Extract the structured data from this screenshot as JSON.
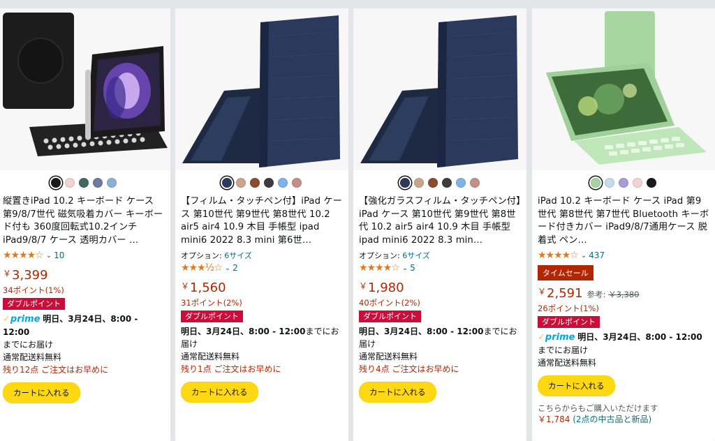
{
  "products": [
    {
      "image_icon": "ipad-keyboard-case-black-icon",
      "swatches": [
        "#1a1a1a",
        "#f2d3d3",
        "#3d6b64",
        "#6f7a9e",
        "#8bb0d4"
      ],
      "title": "縦置きiPad 10.2 キーボード ケース 第9/8/7世代 磁気吸着カバー キーボード付も 360度回転式10.2インチ iPad9/8/7 ケース 透明カバー …",
      "option_label": "",
      "option_value": "",
      "stars": "★★★★☆",
      "rating_value": 4.0,
      "review_count": "10",
      "sale_badge": "",
      "price": "3,399",
      "ref_label": "",
      "ref_price": "",
      "points": "34ポイント(1%)",
      "double_points": "ダブルポイント",
      "prime": true,
      "prime_label": "prime",
      "delivery": "明日、3月24日、8:00 - 12:00",
      "delivery_suffix": "までにお届け",
      "shipping": "通常配送料無料",
      "stock": "残り12点 ご注文はお早めに",
      "cart": "カートに入れる",
      "alt_text": "",
      "alt_price": "",
      "alt_link": ""
    },
    {
      "image_icon": "ipad-folio-case-navy-icon",
      "swatches": [
        "#2e3a5c",
        "#c9a58c",
        "#8c4a2f",
        "#3c3c3c",
        "#7fb3e8",
        "#c48f8a"
      ],
      "title": "【フィルム・タッチペン付】iPad ケース 第10世代 第9世代 第8世代 10.2 air5 air4 10.9 木目 手帳型 ipad mini6 2022 8.3 mini 第6世…",
      "option_label": "オプション:",
      "option_value": "6サイズ",
      "stars": "★★★½☆",
      "rating_value": 3.5,
      "review_count": "2",
      "sale_badge": "",
      "price": "1,560",
      "ref_label": "",
      "ref_price": "",
      "points": "31ポイント(2%)",
      "double_points": "ダブルポイント",
      "prime": false,
      "prime_label": "",
      "delivery": "明日、3月24日、8:00 - 12:00",
      "delivery_suffix": "までにお届け",
      "shipping": "通常配送料無料",
      "stock": "残り1点 ご注文はお早めに",
      "cart": "カートに入れる",
      "alt_text": "",
      "alt_price": "",
      "alt_link": ""
    },
    {
      "image_icon": "ipad-folio-case-navy-icon",
      "swatches": [
        "#2e3a5c",
        "#c9a58c",
        "#8c4a2f",
        "#3c3c3c",
        "#7fb3e8",
        "#c48f8a"
      ],
      "title": "【強化ガラスフィルム・タッチペン付】iPad ケース 第10世代 第9世代 第8世代 10.2 air5 air4 10.9 木目 手帳型 ipad mini6 2022 8.3 min…",
      "option_label": "オプション:",
      "option_value": "6サイズ",
      "stars": "★★★★☆",
      "rating_value": 4.0,
      "review_count": "5",
      "sale_badge": "",
      "price": "1,980",
      "ref_label": "",
      "ref_price": "",
      "points": "40ポイント(2%)",
      "double_points": "ダブルポイント",
      "prime": false,
      "prime_label": "",
      "delivery": "明日、3月24日、8:00 - 12:00",
      "delivery_suffix": "までにお届け",
      "shipping": "通常配送料無料",
      "stock": "残り4点 ご注文はお早めに",
      "cart": "カートに入れる",
      "alt_text": "",
      "alt_price": "",
      "alt_link": ""
    },
    {
      "image_icon": "ipad-keyboard-case-green-icon",
      "swatches": [
        "#a7d4a0",
        "#c7dbea",
        "#a89bd6",
        "#f2d3d3",
        "#1a1a1a"
      ],
      "title": "iPad 10.2 キーボード ケース iPad 第9世代 第8世代 第7世代 Bluetooth キーボード付きカバー iPad9/8/7通用ケース 脱着式 ペン…",
      "option_label": "",
      "option_value": "",
      "stars": "★★★★☆",
      "rating_value": 4.0,
      "review_count": "437",
      "sale_badge": "タイムセール",
      "price": "2,591",
      "ref_label": "参考:",
      "ref_price": "￥3,380",
      "points": "26ポイント(1%)",
      "double_points": "ダブルポイント",
      "prime": true,
      "prime_label": "prime",
      "delivery": "明日、3月24日、8:00 - 12:00",
      "delivery_suffix": "までにお届け",
      "shipping": "通常配送料無料",
      "stock": "",
      "cart": "カートに入れる",
      "alt_text": "こちらからもご購入いただけます",
      "alt_price": "￥1,784",
      "alt_link": "(2点の中古品と新品)"
    }
  ],
  "currency_symbol": "￥"
}
